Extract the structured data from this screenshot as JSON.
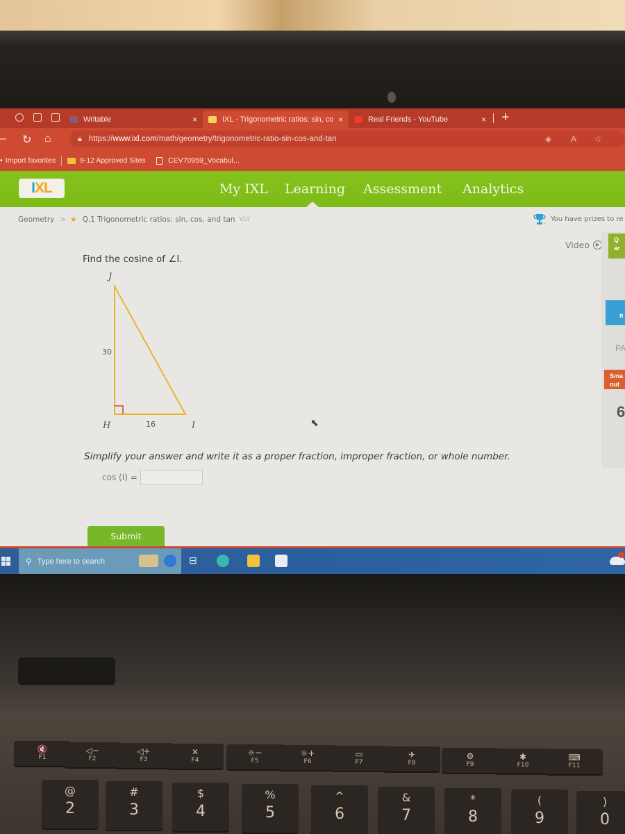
{
  "browser": {
    "tabs": [
      {
        "label": "Writable",
        "active": false
      },
      {
        "label": "IXL - Trigonometric ratios: sin, co",
        "active": true
      },
      {
        "label": "Real Friends - YouTube",
        "active": false
      }
    ],
    "new_tab_label": "+",
    "close_glyph": "×",
    "url_prefix": "https://",
    "url_domain": "www.ixl.com",
    "url_path": "/math/geometry/trigonometric-ratio-sin-cos-and-tan",
    "favorites": [
      {
        "label": "Import favorites",
        "icon": "import-icon"
      },
      {
        "label": "9-12 Approved Sites",
        "icon": "folder-icon"
      },
      {
        "label": "CEV70959_Vocabul...",
        "icon": "document-icon"
      }
    ],
    "colors": {
      "chrome": "#cf4a32",
      "tabstrip": "#b53a28"
    }
  },
  "ixl": {
    "logo": {
      "i": "I",
      "x": "X",
      "l": "L"
    },
    "nav": [
      "My IXL",
      "Learning",
      "Assessment",
      "Analytics"
    ],
    "active_nav": "Learning",
    "colors": {
      "header_green": "#80bf19",
      "submit_green": "#76b82a"
    }
  },
  "breadcrumb": {
    "subject": "Geometry",
    "separator": ">",
    "skill": "Q.1 Trigonometric ratios: sin, cos, and tan",
    "code": "VLY"
  },
  "prizes_text": "You have prizes to re",
  "video_label": "Video",
  "question": {
    "prompt": "Find the cosine of ∠I.",
    "triangle": {
      "vertices": {
        "top": "J",
        "right_angle": "H",
        "bottom_right": "I"
      },
      "side_JH": "30",
      "side_HI": "16"
    },
    "instruction": "Simplify your answer and write it as a proper fraction, improper fraction, or whole number.",
    "answer_label": "cos (I) =",
    "answer_value": "",
    "submit_label": "Submit"
  },
  "side_panel": {
    "green_text": "Q\nar",
    "blue_text": "e",
    "pa_text": "PA",
    "orange_text": "Sma\nout",
    "score_text": "6"
  },
  "taskbar": {
    "search_placeholder": "Type here to search",
    "notification_badge": "1"
  },
  "keyboard": {
    "function_keys": [
      {
        "glyph": "🔇",
        "label": "F1"
      },
      {
        "glyph": "◁−",
        "label": "F2"
      },
      {
        "glyph": "◁+",
        "label": "F3"
      },
      {
        "glyph": "✕",
        "label": "F4"
      },
      {
        "glyph": "☼−",
        "label": "F5"
      },
      {
        "glyph": "☼+",
        "label": "F6"
      },
      {
        "glyph": "▭",
        "label": "F7"
      },
      {
        "glyph": "✈",
        "label": "F8"
      },
      {
        "glyph": "⚙",
        "label": "F9"
      },
      {
        "glyph": "✱",
        "label": "F10"
      },
      {
        "glyph": "⌨",
        "label": "F11"
      }
    ],
    "number_keys": [
      {
        "top": "@",
        "bottom": "2"
      },
      {
        "top": "#",
        "bottom": "3"
      },
      {
        "top": "$",
        "bottom": "4"
      },
      {
        "top": "%",
        "bottom": "5"
      },
      {
        "top": "^",
        "bottom": "6"
      },
      {
        "top": "&",
        "bottom": "7"
      },
      {
        "top": "*",
        "bottom": "8"
      },
      {
        "top": "(",
        "bottom": "9"
      },
      {
        "top": ")",
        "bottom": "0"
      }
    ]
  }
}
